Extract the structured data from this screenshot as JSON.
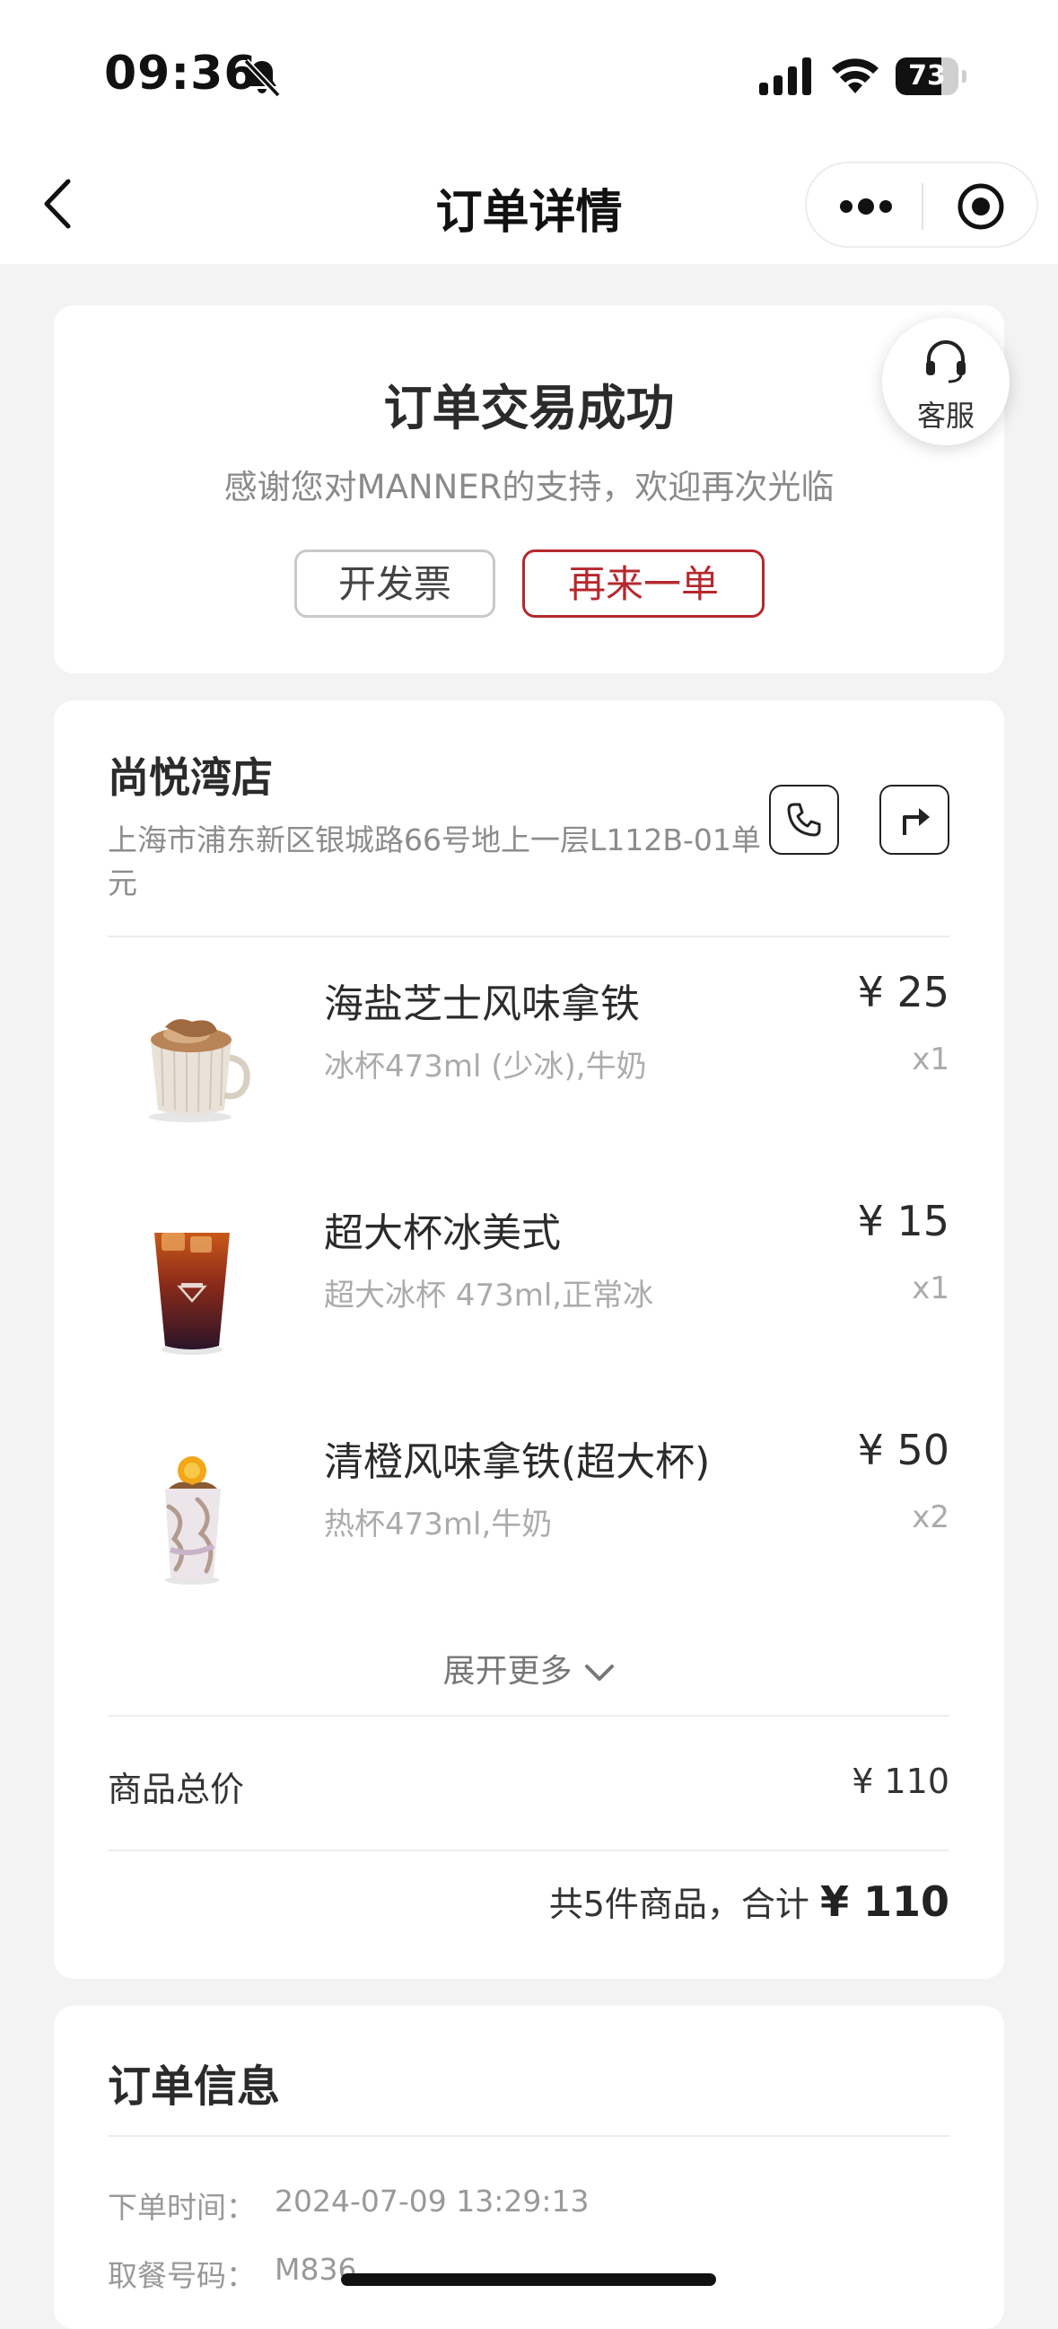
{
  "status_bar": {
    "time": "09:36",
    "battery": "73",
    "battery_level": 0.73
  },
  "nav": {
    "title": "订单详情"
  },
  "success": {
    "title": "订单交易成功",
    "subtitle": "感谢您对MANNER的支持，欢迎再次光临",
    "invoice_label": "开发票",
    "reorder_label": "再来一单",
    "service_label": "客服"
  },
  "store": {
    "name": "尚悦湾店",
    "address": "上海市浦东新区银城路66号地上一层L112B-01单元"
  },
  "items": [
    {
      "name": "海盐芝士风味拿铁",
      "spec": "冰杯473ml (少冰),牛奶",
      "price": "¥ 25",
      "qty": "x1"
    },
    {
      "name": "超大杯冰美式",
      "spec": "超大冰杯 473ml,正常冰",
      "price": "¥ 15",
      "qty": "x1"
    },
    {
      "name": "清橙风味拿铁(超大杯)",
      "spec": "热杯473ml,牛奶",
      "price": "¥ 50",
      "qty": "x2"
    }
  ],
  "expand_label": "展开更多",
  "summary": {
    "subtotal_label": "商品总价",
    "subtotal_value": "¥ 110",
    "total_prefix": "共5件商品，合计 ",
    "total_value": "¥ 110"
  },
  "order_info": {
    "title": "订单信息",
    "rows": [
      {
        "label": "下单时间：",
        "value": "2024-07-09 13:29:13"
      },
      {
        "label": "取餐号码：",
        "value": "M836"
      }
    ]
  },
  "colors": {
    "accent": "#b5282e",
    "background": "#f3f3f3"
  }
}
